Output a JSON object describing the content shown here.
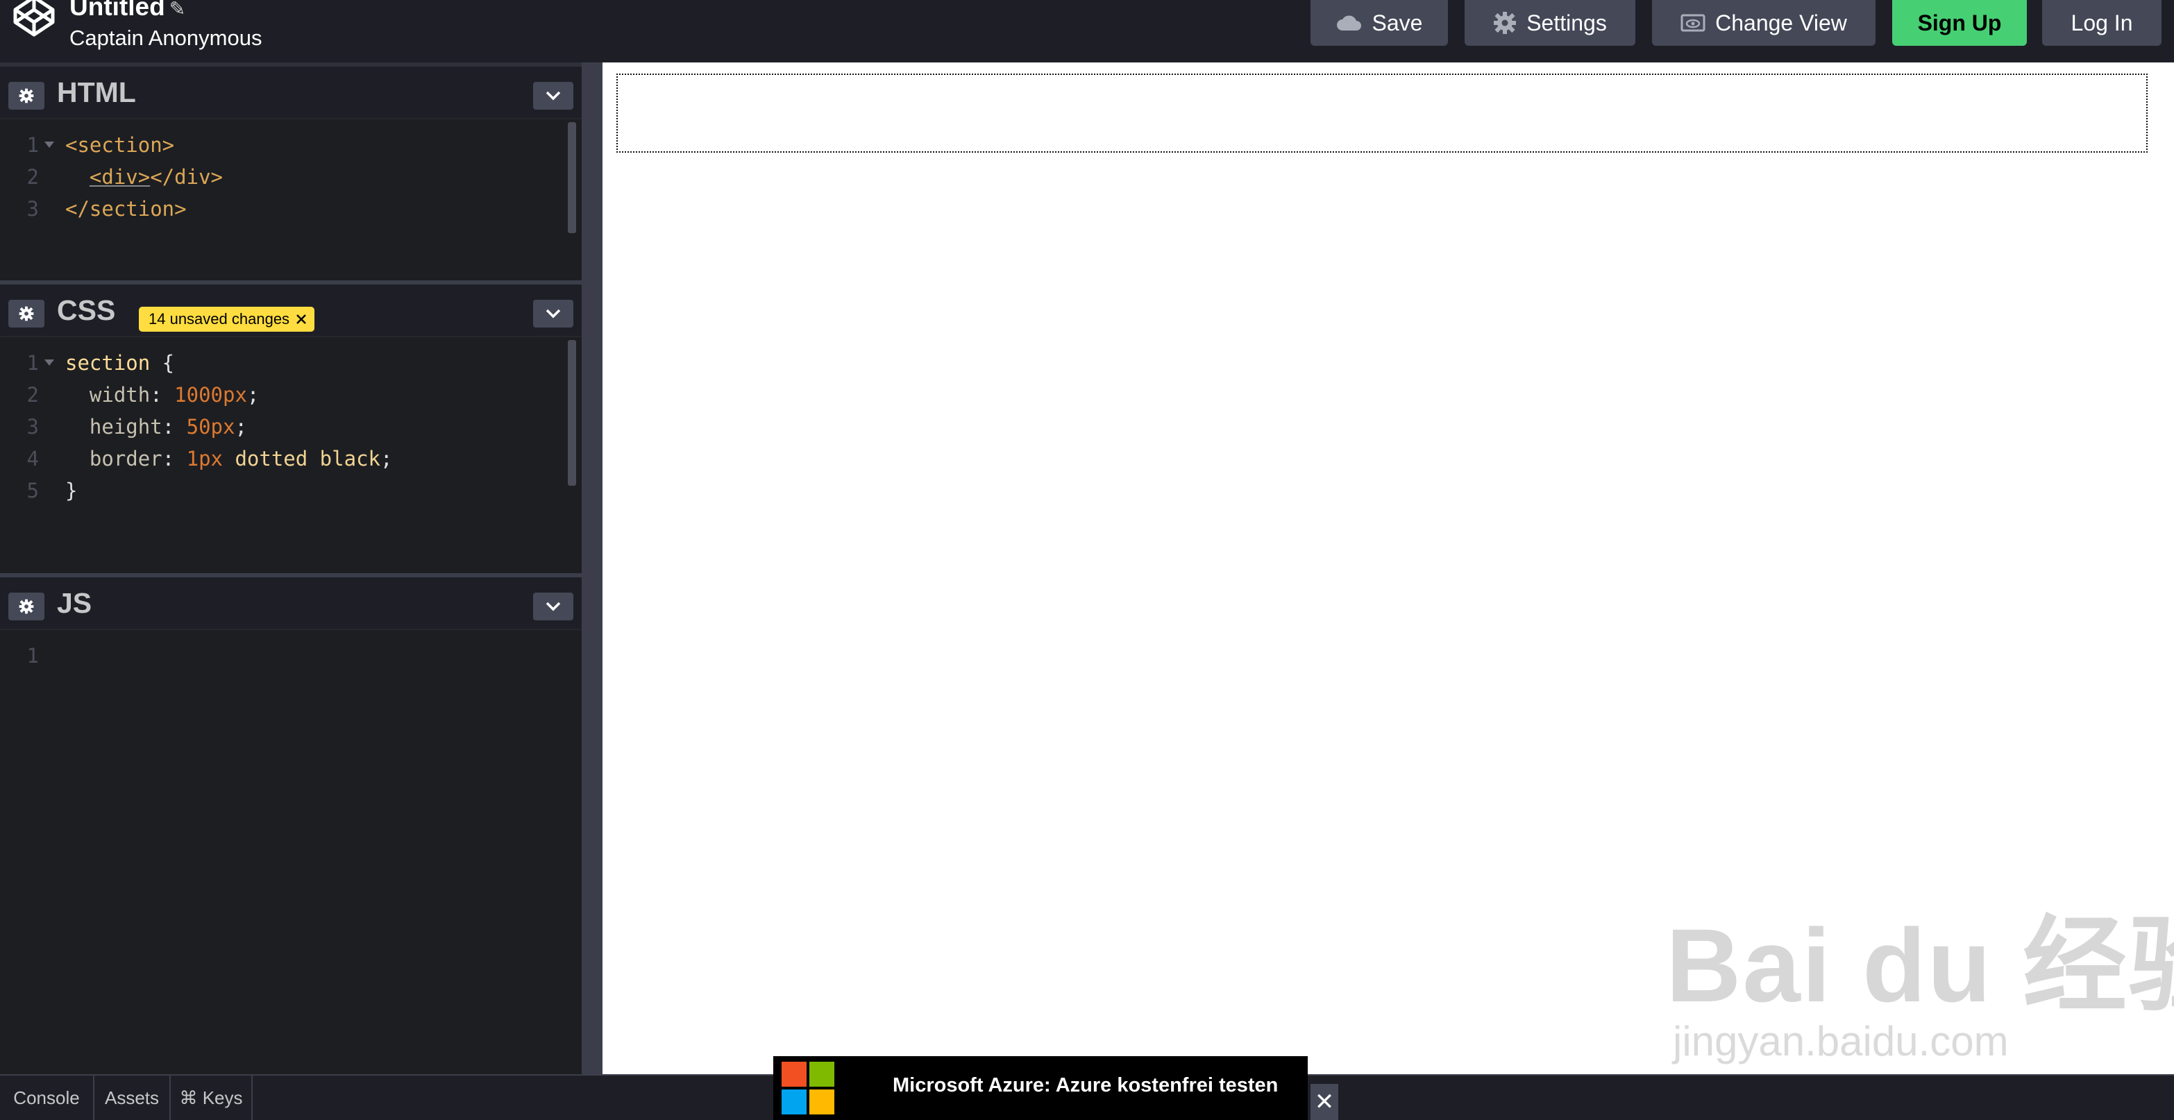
{
  "header": {
    "pen_title": "Untitled",
    "author": "Captain Anonymous",
    "buttons": {
      "save": "Save",
      "settings": "Settings",
      "change_view": "Change View",
      "sign_up": "Sign Up",
      "log_in": "Log In"
    },
    "icons": [
      "codepen-logo-icon",
      "pencil-icon",
      "cloud-icon",
      "gear-icon",
      "eye-icon"
    ]
  },
  "editors": {
    "html": {
      "name": "HTML",
      "lines": [
        {
          "n": "1",
          "parts": [
            [
              "tag",
              "<section>"
            ]
          ]
        },
        {
          "n": "2",
          "parts": [
            [
              "punc",
              "  "
            ],
            [
              "tag-u",
              "<div>"
            ],
            [
              "tag",
              "</div>"
            ]
          ]
        },
        {
          "n": "3",
          "parts": [
            [
              "tag",
              "</section>"
            ]
          ]
        }
      ]
    },
    "css": {
      "name": "CSS",
      "badge": "14 unsaved changes",
      "lines": [
        {
          "n": "1",
          "parts": [
            [
              "sel",
              "section"
            ],
            [
              "punc",
              " {"
            ]
          ]
        },
        {
          "n": "2",
          "parts": [
            [
              "punc",
              "  "
            ],
            [
              "prop",
              "width"
            ],
            [
              "punc",
              ": "
            ],
            [
              "num",
              "1000px"
            ],
            [
              "punc",
              ";"
            ]
          ]
        },
        {
          "n": "3",
          "parts": [
            [
              "punc",
              "  "
            ],
            [
              "prop",
              "height"
            ],
            [
              "punc",
              ": "
            ],
            [
              "num",
              "50px"
            ],
            [
              "punc",
              ";"
            ]
          ]
        },
        {
          "n": "4",
          "parts": [
            [
              "punc",
              "  "
            ],
            [
              "prop",
              "border"
            ],
            [
              "punc",
              ": "
            ],
            [
              "num",
              "1px"
            ],
            [
              "punc",
              " "
            ],
            [
              "val",
              "dotted black"
            ],
            [
              "punc",
              ";"
            ]
          ]
        },
        {
          "n": "5",
          "parts": [
            [
              "punc",
              "}"
            ]
          ]
        }
      ]
    },
    "js": {
      "name": "JS",
      "lines": [
        {
          "n": "1",
          "parts": []
        }
      ]
    }
  },
  "footer": {
    "tabs": {
      "console": "Console",
      "assets": "Assets",
      "keys": "⌘ Keys"
    }
  },
  "ad": {
    "text": "Microsoft Azure: Azure kostenfrei testen",
    "close": "✕",
    "logo_colors": [
      "#f25022",
      "#7fba00",
      "#00a4ef",
      "#ffb900"
    ]
  },
  "watermark": {
    "text": "Bai du 经验",
    "url": "jingyan.baidu.com"
  },
  "colors": {
    "signup_green": "#47cf73",
    "badge_yellow": "#ffdd40",
    "button_gray": "#444857"
  }
}
